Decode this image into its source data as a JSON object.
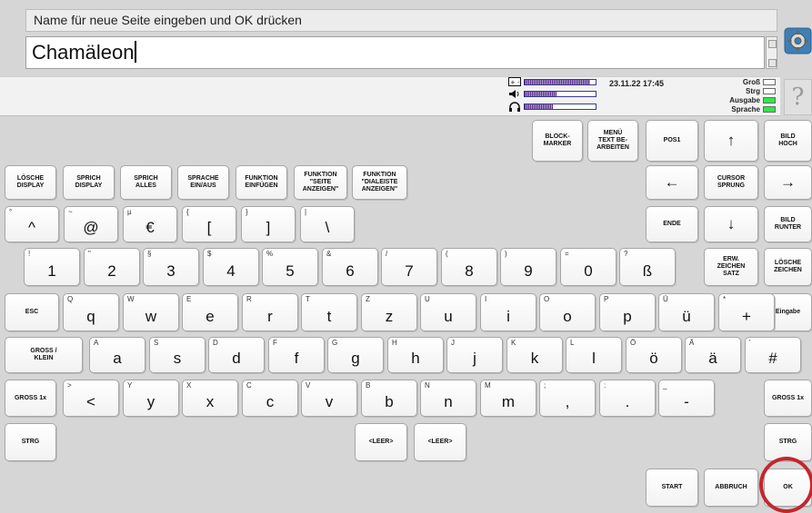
{
  "header": {
    "prompt": "Name für neue Seite eingeben und OK drücken",
    "input_value": "Chamäleon"
  },
  "status": {
    "datetime": "23.11.22 17:45",
    "labels": [
      "Groß",
      "Strg",
      "Ausgabe",
      "Sprache"
    ],
    "indicators_on": [
      false,
      false,
      true,
      true
    ],
    "battery_level": 0.92,
    "volume_level": 0.45,
    "headphone_level": 0.4
  },
  "help_label": "?",
  "command_keys": {
    "block_marker": "BLOCK-\nMARKER",
    "menu_text": "MENÜ\nTEXT BE-\nARBEITEN",
    "pos1": "POS1",
    "up": "↑",
    "page_up": "BILD\nHOCH",
    "clear_display": "LÖSCHE\nDISPLAY",
    "speak_display": "SPRICH\nDISPLAY",
    "speak_all": "SPRICH\nALLES",
    "speech_toggle": "SPRACHE\nEIN/AUS",
    "insert_function": "FUNKTION\nEINFÜGEN",
    "show_page_function": "FUNKTION\n\"SEITE\nANZEIGEN\"",
    "show_dialog_function": "FUNKTION\n\"DIALEISTE\nANZEIGEN\"",
    "left": "←",
    "cursor_jump": "CURSOR\nSPRUNG",
    "right": "→",
    "end": "ENDE",
    "down": "↓",
    "page_down": "BILD\nRUNTER",
    "extended_charset": "ERW.\nZEICHEN\nSATZ",
    "delete_chars": "LÖSCHE\nZEICHEN",
    "esc": "ESC",
    "enter": "Eingabe",
    "caps": "GROSS /\nKLEIN",
    "shift_once_left": "GROSS 1x",
    "shift_once_right": "GROSS 1x",
    "ctrl_left": "STRG",
    "ctrl_right": "STRG",
    "space1": "<LEER>",
    "space2": "<LEER>",
    "start": "START",
    "cancel": "ABBRUCH",
    "ok": "OK"
  },
  "rows": {
    "symbols": [
      {
        "main": "^",
        "sub": "°"
      },
      {
        "main": "@",
        "sub": "~"
      },
      {
        "main": "€",
        "sub": "µ"
      },
      {
        "main": "[",
        "sub": "{"
      },
      {
        "main": "]",
        "sub": "}"
      },
      {
        "main": "\\",
        "sub": "|"
      }
    ],
    "numbers": [
      {
        "main": "1",
        "sub": "!"
      },
      {
        "main": "2",
        "sub": "\""
      },
      {
        "main": "3",
        "sub": "§"
      },
      {
        "main": "4",
        "sub": "$"
      },
      {
        "main": "5",
        "sub": "%"
      },
      {
        "main": "6",
        "sub": "&"
      },
      {
        "main": "7",
        "sub": "/"
      },
      {
        "main": "8",
        "sub": "("
      },
      {
        "main": "9",
        "sub": ")"
      },
      {
        "main": "0",
        "sub": "="
      },
      {
        "main": "ß",
        "sub": "?"
      }
    ],
    "qwertz": [
      {
        "main": "q",
        "sub": "Q"
      },
      {
        "main": "w",
        "sub": "W"
      },
      {
        "main": "e",
        "sub": "E"
      },
      {
        "main": "r",
        "sub": "R"
      },
      {
        "main": "t",
        "sub": "T"
      },
      {
        "main": "z",
        "sub": "Z"
      },
      {
        "main": "u",
        "sub": "U"
      },
      {
        "main": "i",
        "sub": "I"
      },
      {
        "main": "o",
        "sub": "O"
      },
      {
        "main": "p",
        "sub": "P"
      },
      {
        "main": "ü",
        "sub": "Ü"
      },
      {
        "main": "+",
        "sub": "*"
      }
    ],
    "asdf": [
      {
        "main": "a",
        "sub": "A"
      },
      {
        "main": "s",
        "sub": "S"
      },
      {
        "main": "d",
        "sub": "D"
      },
      {
        "main": "f",
        "sub": "F"
      },
      {
        "main": "g",
        "sub": "G"
      },
      {
        "main": "h",
        "sub": "H"
      },
      {
        "main": "j",
        "sub": "J"
      },
      {
        "main": "k",
        "sub": "K"
      },
      {
        "main": "l",
        "sub": "L"
      },
      {
        "main": "ö",
        "sub": "Ö"
      },
      {
        "main": "ä",
        "sub": "Ä"
      },
      {
        "main": "#",
        "sub": "'"
      }
    ],
    "yxcv": [
      {
        "main": "<",
        "sub": ">"
      },
      {
        "main": "y",
        "sub": "Y"
      },
      {
        "main": "x",
        "sub": "X"
      },
      {
        "main": "c",
        "sub": "C"
      },
      {
        "main": "v",
        "sub": "V"
      },
      {
        "main": "b",
        "sub": "B"
      },
      {
        "main": "n",
        "sub": "N"
      },
      {
        "main": "m",
        "sub": "M"
      },
      {
        "main": ",",
        "sub": ";"
      },
      {
        "main": ".",
        "sub": ":"
      },
      {
        "main": "-",
        "sub": "_"
      }
    ]
  },
  "colors": {
    "indicator_on": "#2ee84a",
    "highlight_ring": "#c3262d"
  },
  "icons": [
    "settings-gear-icon",
    "battery-icon",
    "speaker-icon",
    "headphones-icon",
    "help-icon"
  ]
}
